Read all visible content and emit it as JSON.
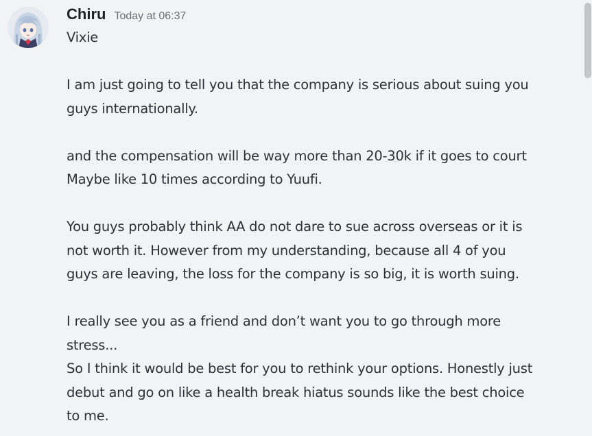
{
  "message": {
    "author": "Chiru",
    "timestamp": "Today at 06:37",
    "avatar_icon": "anime-avatar",
    "paragraphs": [
      {
        "lines": [
          "Vixie"
        ]
      },
      {
        "lines": [
          "I am just going to tell you that the company is serious about suing you",
          "guys internationally."
        ]
      },
      {
        "lines": [
          "and the compensation will be way more than 20-30k if it goes to court",
          "Maybe like 10 times according to Yuufi."
        ]
      },
      {
        "lines": [
          "You guys probably think AA do not dare to sue across overseas or it is",
          "not worth it. However from my understanding, because all 4 of you",
          "guys are leaving, the loss for the company is so big, it is worth suing."
        ]
      },
      {
        "lines": [
          "I really see you as a friend and don’t want you to go through more",
          "stress...",
          "So I think it would be best for you to rethink your options. Honestly just",
          "debut and go on like a health break hiatus sounds like the best choice",
          "to me."
        ]
      }
    ]
  },
  "colors": {
    "background": "#f2f3f5",
    "username": "#1f2124",
    "timestamp": "#6a6e75",
    "text": "#2e3035",
    "scrollbar": "#c4c6cc"
  }
}
